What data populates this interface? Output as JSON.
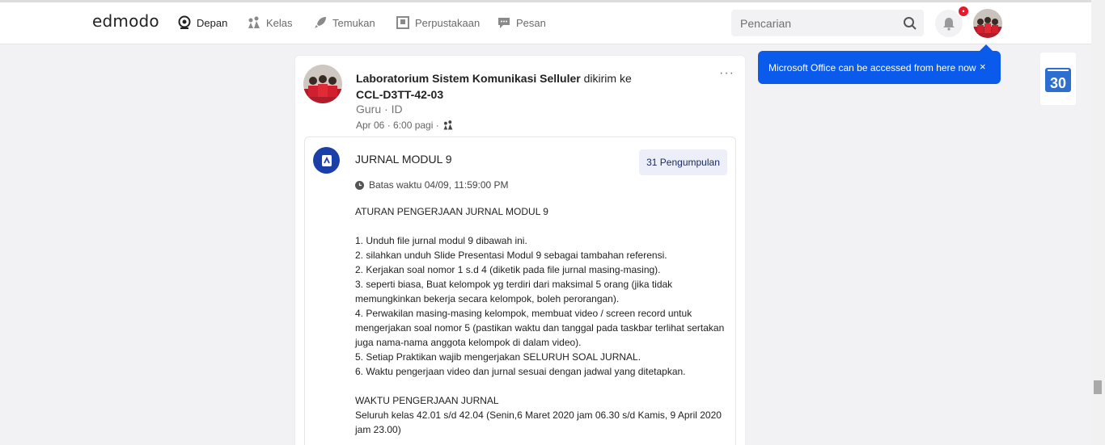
{
  "nav": {
    "logo": "edmodo",
    "items": [
      {
        "label": "Depan",
        "icon": "home-icon"
      },
      {
        "label": "Kelas",
        "icon": "classes-icon"
      },
      {
        "label": "Temukan",
        "icon": "rocket-icon"
      },
      {
        "label": "Perpustakaan",
        "icon": "library-icon"
      },
      {
        "label": "Pesan",
        "icon": "message-icon"
      }
    ],
    "search_placeholder": "Pencarian",
    "notification_badge": "•"
  },
  "post": {
    "sender": "Laboratorium Sistem Komunikasi Selluler",
    "sent_to": " dikirim ke",
    "group": "CCL-D3TT-42-03",
    "role": "Guru · ID",
    "date": "Apr 06 · 6:00 pagi ·",
    "more": "···",
    "assignment": {
      "title": "JURNAL MODUL 9",
      "submissions": "31 Pengumpulan",
      "due": "Batas waktu 04/09, 11:59:00 PM",
      "lines": [
        "ATURAN PENGERJAAN JURNAL MODUL 9",
        "",
        "1. Unduh file jurnal modul 9 dibawah ini.",
        "2. silahkan unduh Slide Presentasi Modul 9 sebagai tambahan referensi.",
        "2. Kerjakan soal nomor 1 s.d 4 (diketik pada file jurnal masing-masing).",
        "3. seperti biasa, Buat kelompok yg terdiri dari maksimal 5 orang (jika tidak memungkinkan bekerja secara kelompok, boleh perorangan).",
        "4. Perwakilan masing-masing kelompok, membuat video / screen record untuk mengerjakan soal nomor 5 (pastikan waktu dan tanggal pada taskbar terlihat sertakan juga nama-nama anggota kelompok di dalam video).",
        "5. Setiap Praktikan wajib mengerjakan SELURUH SOAL JURNAL.",
        "6. Waktu pengerjaan video dan jurnal sesuai dengan jadwal yang ditetapkan.",
        "",
        "WAKTU PENGERJAAN JURNAL",
        "Seluruh kelas 42.01 s/d 42.04 (Senin,6 Maret 2020 jam 06.30 s/d Kamis, 9 April 2020 jam 23.00)"
      ]
    }
  },
  "toast": {
    "message": "Microsoft Office can be accessed from here now",
    "close": "×"
  },
  "calendar": {
    "day": "30"
  }
}
